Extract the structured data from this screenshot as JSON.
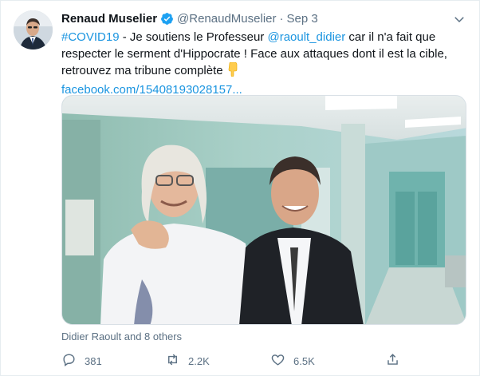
{
  "tweet": {
    "name": "Renaud Muselier",
    "handle": "@RenaudMuselier",
    "separator": "·",
    "date": "Sep 3",
    "line1_hashtag": "#COVID19",
    "line1_text_a": " - Je soutiens le Professeur ",
    "line1_mention": "@raoult_didier",
    "line1_text_b": " car il n'a fait que",
    "line2": "respecter le serment d'Hippocrate ! Face aux attaques dont il est la cible,",
    "line3": "retrouvez ma tribune complète",
    "link": "facebook.com/15408193028157...",
    "tagged": "Didier Raoult and 8 others"
  },
  "actions": {
    "reply_count": "381",
    "retweet_count": "2.2K",
    "like_count": "6.5K"
  },
  "icons": {
    "verified": "verified-badge-icon",
    "caret": "chevron-down-icon",
    "emoji": "backhand-index-pointing-down-emoji",
    "reply": "reply-icon",
    "retweet": "retweet-icon",
    "like": "heart-icon",
    "share": "share-icon"
  },
  "colors": {
    "link": "#1b95e0",
    "secondary_text": "#5b7083",
    "verified": "#1da1f2"
  }
}
